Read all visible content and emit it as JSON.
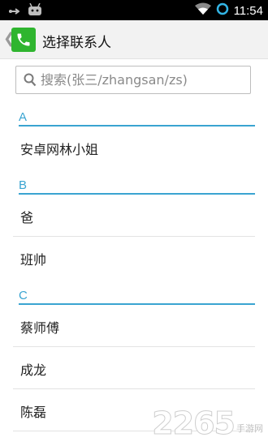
{
  "status_bar": {
    "time": "11:54",
    "icons": [
      "usb-icon",
      "android-icon",
      "wifi-icon",
      "sync-icon"
    ]
  },
  "action_bar": {
    "back_glyph": "❮",
    "app_icon": "phone-icon",
    "title": "选择联系人",
    "accent_color": "#2fb52f"
  },
  "search": {
    "placeholder": "搜索(张三/zhangsan/zs)",
    "value": ""
  },
  "sections": [
    {
      "letter": "A",
      "contacts": [
        "安卓网林小姐"
      ]
    },
    {
      "letter": "B",
      "contacts": [
        "爸",
        "班帅"
      ]
    },
    {
      "letter": "C",
      "contacts": [
        "蔡师傅",
        "成龙",
        "陈磊"
      ]
    }
  ],
  "colors": {
    "section_accent": "#3aa4d1",
    "divider": "#e3e3e3"
  },
  "watermark": {
    "digits": "2265",
    "text": "手游网"
  }
}
